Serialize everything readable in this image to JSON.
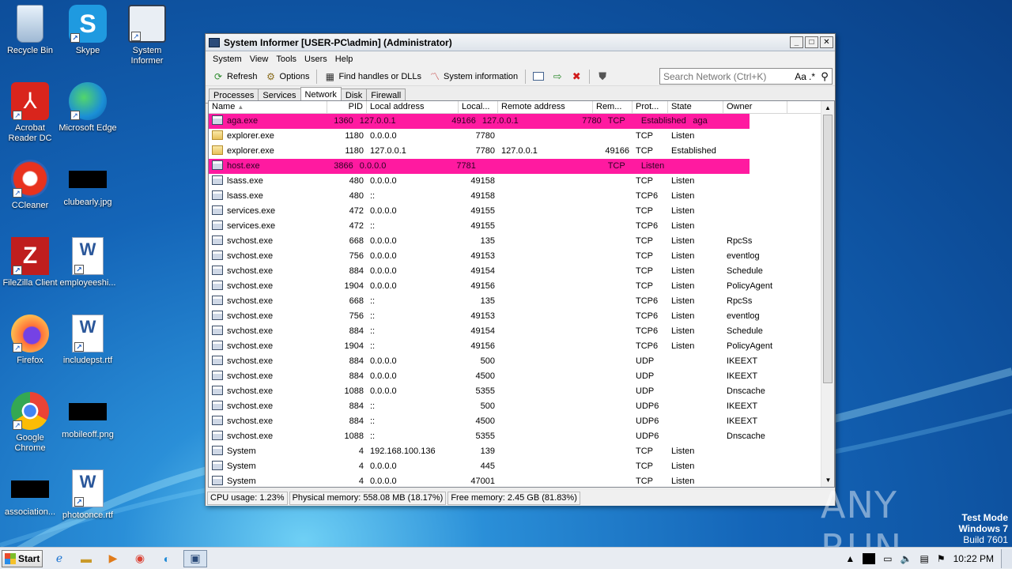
{
  "desktop": {
    "icons": [
      {
        "label": "Recycle Bin",
        "icon": "recycle-bin-icon"
      },
      {
        "label": "Skype",
        "icon": "skype-icon"
      },
      {
        "label": "System Informer",
        "icon": "system-informer-icon"
      },
      {
        "label": "Acrobat Reader DC",
        "icon": "acrobat-icon"
      },
      {
        "label": "Microsoft Edge",
        "icon": "edge-icon"
      },
      {
        "label": "CCleaner",
        "icon": "ccleaner-icon"
      },
      {
        "label": "clubearly.jpg",
        "icon": "image-file-icon"
      },
      {
        "label": "FileZilla Client",
        "icon": "filezilla-icon"
      },
      {
        "label": "employeeshi...",
        "icon": "word-doc-icon"
      },
      {
        "label": "Firefox",
        "icon": "firefox-icon"
      },
      {
        "label": "includepst.rtf",
        "icon": "word-doc-icon"
      },
      {
        "label": "Google Chrome",
        "icon": "chrome-icon"
      },
      {
        "label": "mobileoff.png",
        "icon": "image-file-icon"
      },
      {
        "label": "association...",
        "icon": "image-file-icon"
      },
      {
        "label": "photoonce.rtf",
        "icon": "word-doc-icon"
      }
    ]
  },
  "window": {
    "title": "System Informer [USER-PC\\admin] (Administrator)",
    "menu": [
      "System",
      "View",
      "Tools",
      "Users",
      "Help"
    ],
    "toolbar": {
      "refresh": "Refresh",
      "options": "Options",
      "find_handles": "Find handles or DLLs",
      "system_information": "System information"
    },
    "search": {
      "placeholder": "Search Network (Ctrl+K)",
      "aa": "Aa",
      "regex": ".*"
    },
    "tabs": [
      "Processes",
      "Services",
      "Network",
      "Disk",
      "Firewall"
    ],
    "active_tab": "Network",
    "columns": [
      "Name",
      "PID",
      "Local address",
      "Local...",
      "Remote address",
      "Rem...",
      "Prot...",
      "State",
      "Owner"
    ],
    "rows": [
      {
        "name": "aga.exe",
        "pid": "1360",
        "la": "127.0.0.1",
        "lp": "49166",
        "ra": "127.0.0.1",
        "rp": "7780",
        "proto": "TCP",
        "state": "Established",
        "owner": "aga",
        "highlight": true,
        "icon": "process-icon"
      },
      {
        "name": "explorer.exe",
        "pid": "1180",
        "la": "0.0.0.0",
        "lp": "7780",
        "ra": "",
        "rp": "",
        "proto": "TCP",
        "state": "Listen",
        "owner": "",
        "highlight": false,
        "icon": "folder-icon"
      },
      {
        "name": "explorer.exe",
        "pid": "1180",
        "la": "127.0.0.1",
        "lp": "7780",
        "ra": "127.0.0.1",
        "rp": "49166",
        "proto": "TCP",
        "state": "Established",
        "owner": "",
        "highlight": false,
        "icon": "folder-icon"
      },
      {
        "name": "host.exe",
        "pid": "3866",
        "la": "0.0.0.0",
        "lp": "7781",
        "ra": "",
        "rp": "",
        "proto": "TCP",
        "state": "Listen",
        "owner": "",
        "highlight": true,
        "icon": "process-icon"
      },
      {
        "name": "lsass.exe",
        "pid": "480",
        "la": "0.0.0.0",
        "lp": "49158",
        "ra": "",
        "rp": "",
        "proto": "TCP",
        "state": "Listen",
        "owner": "",
        "highlight": false,
        "icon": "process-icon"
      },
      {
        "name": "lsass.exe",
        "pid": "480",
        "la": "::",
        "lp": "49158",
        "ra": "",
        "rp": "",
        "proto": "TCP6",
        "state": "Listen",
        "owner": "",
        "highlight": false,
        "icon": "process-icon"
      },
      {
        "name": "services.exe",
        "pid": "472",
        "la": "0.0.0.0",
        "lp": "49155",
        "ra": "",
        "rp": "",
        "proto": "TCP",
        "state": "Listen",
        "owner": "",
        "highlight": false,
        "icon": "process-icon"
      },
      {
        "name": "services.exe",
        "pid": "472",
        "la": "::",
        "lp": "49155",
        "ra": "",
        "rp": "",
        "proto": "TCP6",
        "state": "Listen",
        "owner": "",
        "highlight": false,
        "icon": "process-icon"
      },
      {
        "name": "svchost.exe",
        "pid": "668",
        "la": "0.0.0.0",
        "lp": "135",
        "ra": "",
        "rp": "",
        "proto": "TCP",
        "state": "Listen",
        "owner": "RpcSs",
        "highlight": false,
        "icon": "process-icon"
      },
      {
        "name": "svchost.exe",
        "pid": "756",
        "la": "0.0.0.0",
        "lp": "49153",
        "ra": "",
        "rp": "",
        "proto": "TCP",
        "state": "Listen",
        "owner": "eventlog",
        "highlight": false,
        "icon": "process-icon"
      },
      {
        "name": "svchost.exe",
        "pid": "884",
        "la": "0.0.0.0",
        "lp": "49154",
        "ra": "",
        "rp": "",
        "proto": "TCP",
        "state": "Listen",
        "owner": "Schedule",
        "highlight": false,
        "icon": "process-icon"
      },
      {
        "name": "svchost.exe",
        "pid": "1904",
        "la": "0.0.0.0",
        "lp": "49156",
        "ra": "",
        "rp": "",
        "proto": "TCP",
        "state": "Listen",
        "owner": "PolicyAgent",
        "highlight": false,
        "icon": "process-icon"
      },
      {
        "name": "svchost.exe",
        "pid": "668",
        "la": "::",
        "lp": "135",
        "ra": "",
        "rp": "",
        "proto": "TCP6",
        "state": "Listen",
        "owner": "RpcSs",
        "highlight": false,
        "icon": "process-icon"
      },
      {
        "name": "svchost.exe",
        "pid": "756",
        "la": "::",
        "lp": "49153",
        "ra": "",
        "rp": "",
        "proto": "TCP6",
        "state": "Listen",
        "owner": "eventlog",
        "highlight": false,
        "icon": "process-icon"
      },
      {
        "name": "svchost.exe",
        "pid": "884",
        "la": "::",
        "lp": "49154",
        "ra": "",
        "rp": "",
        "proto": "TCP6",
        "state": "Listen",
        "owner": "Schedule",
        "highlight": false,
        "icon": "process-icon"
      },
      {
        "name": "svchost.exe",
        "pid": "1904",
        "la": "::",
        "lp": "49156",
        "ra": "",
        "rp": "",
        "proto": "TCP6",
        "state": "Listen",
        "owner": "PolicyAgent",
        "highlight": false,
        "icon": "process-icon"
      },
      {
        "name": "svchost.exe",
        "pid": "884",
        "la": "0.0.0.0",
        "lp": "500",
        "ra": "",
        "rp": "",
        "proto": "UDP",
        "state": "",
        "owner": "IKEEXT",
        "highlight": false,
        "icon": "process-icon"
      },
      {
        "name": "svchost.exe",
        "pid": "884",
        "la": "0.0.0.0",
        "lp": "4500",
        "ra": "",
        "rp": "",
        "proto": "UDP",
        "state": "",
        "owner": "IKEEXT",
        "highlight": false,
        "icon": "process-icon"
      },
      {
        "name": "svchost.exe",
        "pid": "1088",
        "la": "0.0.0.0",
        "lp": "5355",
        "ra": "",
        "rp": "",
        "proto": "UDP",
        "state": "",
        "owner": "Dnscache",
        "highlight": false,
        "icon": "process-icon"
      },
      {
        "name": "svchost.exe",
        "pid": "884",
        "la": "::",
        "lp": "500",
        "ra": "",
        "rp": "",
        "proto": "UDP6",
        "state": "",
        "owner": "IKEEXT",
        "highlight": false,
        "icon": "process-icon"
      },
      {
        "name": "svchost.exe",
        "pid": "884",
        "la": "::",
        "lp": "4500",
        "ra": "",
        "rp": "",
        "proto": "UDP6",
        "state": "",
        "owner": "IKEEXT",
        "highlight": false,
        "icon": "process-icon"
      },
      {
        "name": "svchost.exe",
        "pid": "1088",
        "la": "::",
        "lp": "5355",
        "ra": "",
        "rp": "",
        "proto": "UDP6",
        "state": "",
        "owner": "Dnscache",
        "highlight": false,
        "icon": "process-icon"
      },
      {
        "name": "System",
        "pid": "4",
        "la": "192.168.100.136",
        "lp": "139",
        "ra": "",
        "rp": "",
        "proto": "TCP",
        "state": "Listen",
        "owner": "",
        "highlight": false,
        "icon": "process-icon"
      },
      {
        "name": "System",
        "pid": "4",
        "la": "0.0.0.0",
        "lp": "445",
        "ra": "",
        "rp": "",
        "proto": "TCP",
        "state": "Listen",
        "owner": "",
        "highlight": false,
        "icon": "process-icon"
      },
      {
        "name": "System",
        "pid": "4",
        "la": "0.0.0.0",
        "lp": "47001",
        "ra": "",
        "rp": "",
        "proto": "TCP",
        "state": "Listen",
        "owner": "",
        "highlight": false,
        "icon": "process-icon"
      }
    ],
    "status": {
      "cpu": "CPU usage: 1.23%",
      "physical": "Physical memory: 558.08 MB (18.17%)",
      "free": "Free memory: 2.45 GB (81.83%)"
    }
  },
  "taskbar": {
    "start": "Start",
    "clock": "10:22 PM",
    "apps": [
      "ie-icon",
      "explorer-icon",
      "media-player-icon",
      "chrome-icon",
      "edge-icon",
      "system-informer-icon"
    ]
  },
  "watermark": {
    "line1": "Test Mode",
    "line2": "Windows 7",
    "line3": "Build 7601",
    "brand": "ANY RUN"
  },
  "colors": {
    "highlight": "#ff1aa0",
    "desktop": "#1465b8"
  }
}
